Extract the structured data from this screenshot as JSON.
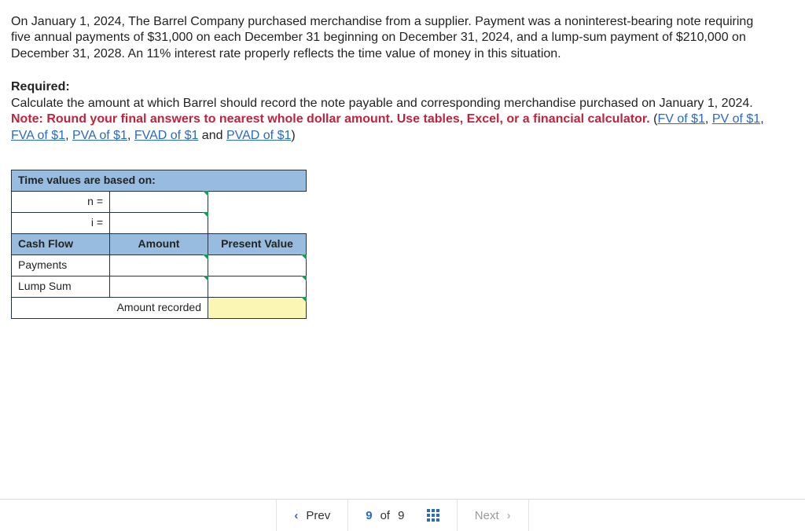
{
  "problem": {
    "paragraph1": "On January 1, 2024, The Barrel Company purchased merchandise from a supplier. Payment was a noninterest-bearing note requiring five annual payments of $31,000 on each December 31 beginning on December 31, 2024, and a lump-sum payment of $210,000 on December 31, 2028. An 11% interest rate properly reflects the time value of money in this situation.",
    "required_label": "Required:",
    "required_text": "Calculate the amount at which Barrel should record the note payable and corresponding merchandise purchased on January 1, 2024.",
    "note_bold": "Note: Round your final answers to nearest whole dollar amount. Use tables, Excel, or a financial calculator.",
    "links": {
      "fv": "FV of $1",
      "pv": "PV of $1",
      "fva": "FVA of $1",
      "pva": "PVA of $1",
      "fvad": "FVAD of $1",
      "pvad": "PVAD of $1"
    },
    "and_word": " and ",
    "open_paren": " (",
    "close_paren": ")",
    "comma_sep": ", "
  },
  "table": {
    "title": "Time values are based on:",
    "n_label": "n =",
    "i_label": "i =",
    "n_value": "",
    "i_value": "",
    "col_cashflow": "Cash Flow",
    "col_amount": "Amount",
    "col_pv": "Present Value",
    "rows": {
      "payments_label": "Payments",
      "payments_amount": "",
      "payments_pv": "",
      "lump_label": "Lump Sum",
      "lump_amount": "",
      "lump_pv": "",
      "total_label": "Amount recorded",
      "total_value": ""
    }
  },
  "nav": {
    "prev": "Prev",
    "next": "Next",
    "current": "9",
    "of_word": "of",
    "total": "9"
  }
}
